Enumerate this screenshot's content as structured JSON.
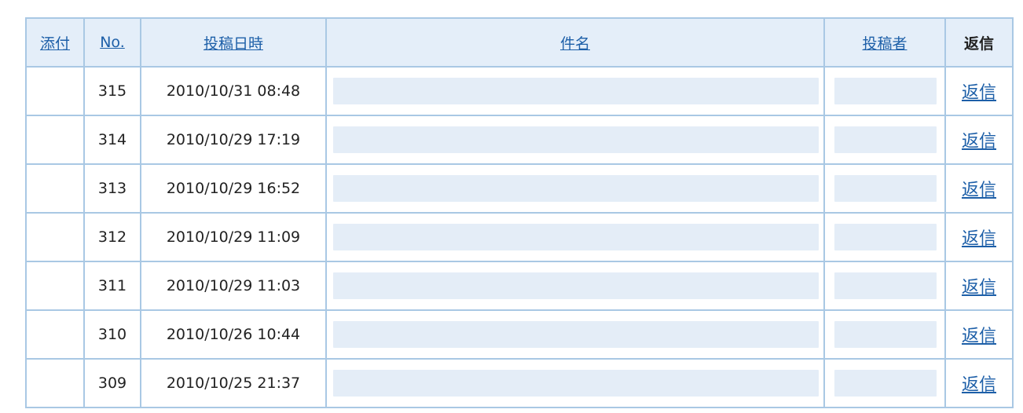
{
  "table": {
    "headers": {
      "attachment": "添付",
      "no": "No.",
      "datetime": "投稿日時",
      "subject": "件名",
      "poster": "投稿者",
      "reply": "返信"
    },
    "rows": [
      {
        "no": "315",
        "datetime": "2010/10/31 08:48",
        "reply": "返信"
      },
      {
        "no": "314",
        "datetime": "2010/10/29 17:19",
        "reply": "返信"
      },
      {
        "no": "313",
        "datetime": "2010/10/29 16:52",
        "reply": "返信"
      },
      {
        "no": "312",
        "datetime": "2010/10/29 11:09",
        "reply": "返信"
      },
      {
        "no": "311",
        "datetime": "2010/10/29 11:03",
        "reply": "返信"
      },
      {
        "no": "310",
        "datetime": "2010/10/26 10:44",
        "reply": "返信"
      },
      {
        "no": "309",
        "datetime": "2010/10/25 21:37",
        "reply": "返信"
      }
    ]
  },
  "colors": {
    "border": "#a9c8e4",
    "header_bg": "#e4eef9",
    "link": "#1d5fa8",
    "redacted_fill": "#e4edf7"
  }
}
